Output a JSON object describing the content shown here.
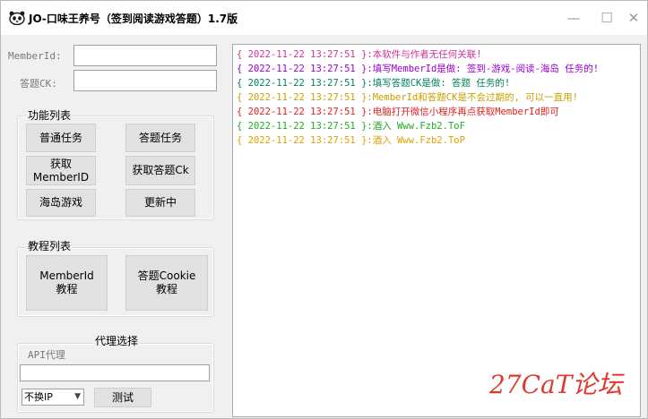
{
  "window": {
    "title": "JO-口味王养号（签到阅读游戏答题）1.7版",
    "controls": {
      "minimize": "—",
      "maximize": "☐",
      "close": "✕"
    }
  },
  "form": {
    "member_id_label": "MemberId:",
    "member_id_value": "",
    "ck_label": "答题CK:",
    "ck_value": ""
  },
  "functions": {
    "title": "功能列表",
    "buttons": [
      "普通任务",
      "答题任务",
      "获取\nMemberID",
      "获取答题Ck",
      "海岛游戏",
      "更新中"
    ]
  },
  "tutorials": {
    "title": "教程列表",
    "buttons": [
      "MemberId\n教程",
      "答题Cookie\n教程"
    ]
  },
  "proxy": {
    "title": "代理选择",
    "api_label": "API代理",
    "api_value": "",
    "select_value": "不换IP",
    "test_label": "测试"
  },
  "log": [
    {
      "time": "{ 2022-11-22 13:27:51 }",
      "msg": ":本软件与作者无任何关联!",
      "color": "#cc3399"
    },
    {
      "time": "{ 2022-11-22 13:27:51 }",
      "msg": ":填写MemberId是做: 签到-游戏-阅读-海岛 任务的!",
      "color": "#9900cc"
    },
    {
      "time": "{ 2022-11-22 13:27:51 }",
      "msg": ":填写答题CK是做: 答题 任务的!",
      "color": "#008060"
    },
    {
      "time": "{ 2022-11-22 13:27:51 }",
      "msg": ":MemberId和答题CK是不会过期的, 可以一直用!",
      "color": "#c8a000"
    },
    {
      "time": "{ 2022-11-22 13:27:51 }",
      "msg": ":电脑打开微信小程序再点获取MemberId即可",
      "color": "#e02020"
    },
    {
      "time": "{ 2022-11-22 13:27:51 }",
      "msg": ":酒入 Www.Fzb2.ToF",
      "color": "#22aa22"
    },
    {
      "time": "{ 2022-11-22 13:27:51 }",
      "msg": ":酒入 Www.Fzb2.ToP",
      "color": "#e0a000"
    }
  ],
  "watermark": "27CaT论坛",
  "icons": {
    "app": "panda-icon",
    "dropdown": "chevron-down-icon"
  }
}
